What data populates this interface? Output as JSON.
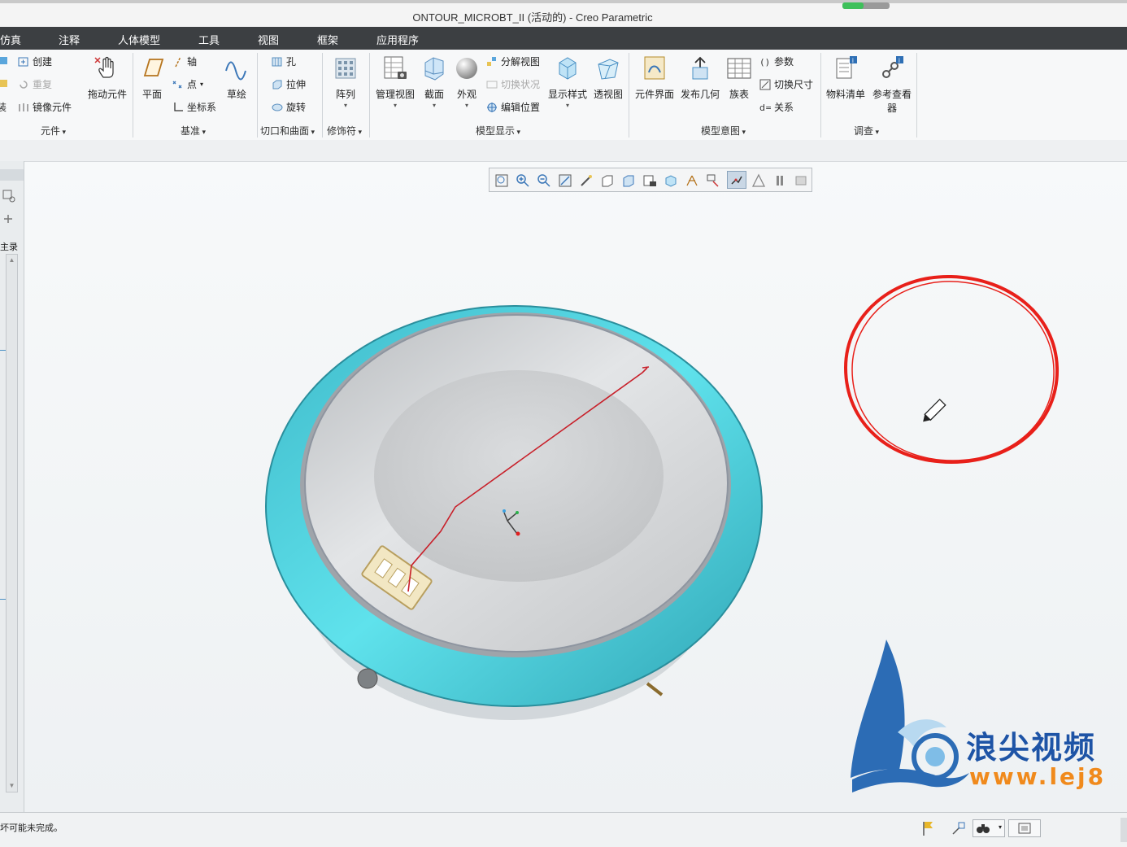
{
  "window": {
    "title": "ONTOUR_MICROBT_II (活动的) - Creo Parametric",
    "progress": 0.45
  },
  "menu": [
    "仿真",
    "注释",
    "人体模型",
    "工具",
    "视图",
    "框架",
    "应用程序"
  ],
  "ribbon": {
    "component": {
      "create": "创建",
      "repeat": "重复",
      "mirror": "镜像元件",
      "assemble_partial": "装",
      "drag": "拖动元件",
      "label": "元件"
    },
    "datum": {
      "plane": "平面",
      "axis": "轴",
      "point": "点",
      "csys": "坐标系",
      "sketch": "草绘",
      "label": "基准"
    },
    "cuts": {
      "hole": "孔",
      "extrude": "拉伸",
      "revolve": "旋转",
      "label": "切口和曲面"
    },
    "modifiers": {
      "pattern": "阵列",
      "label": "修饰符"
    },
    "model_display": {
      "manage_views": "管理视图",
      "section": "截面",
      "appearance": "外观",
      "exploded": "分解视图",
      "toggle_status": "切换状况",
      "edit_position": "编辑位置",
      "display_style": "显示样式",
      "perspective": "透视图",
      "label": "模型显示"
    },
    "model_intent": {
      "component_interface": "元件界面",
      "publish_geometry": "发布几何",
      "family_table": "族表",
      "parameters": "参数",
      "switch_dimensions": "切换尺寸",
      "relations": "关系",
      "label": "模型意图"
    },
    "investigate": {
      "bom": "物料清单",
      "reference_viewer": "参考查看器",
      "label": "调查"
    }
  },
  "left_panel": {
    "tab_label": "主录"
  },
  "status": {
    "message": "坏可能未完成。"
  },
  "watermark": {
    "brand": "浪尖视频",
    "url": "www.lej8"
  },
  "colors": {
    "menubar": "#3c3f42",
    "model_teal": "#4fcfdc",
    "annotation_red": "#e8201a",
    "watermark_blue": "#1e54a6",
    "watermark_orange": "#f08a1c"
  }
}
